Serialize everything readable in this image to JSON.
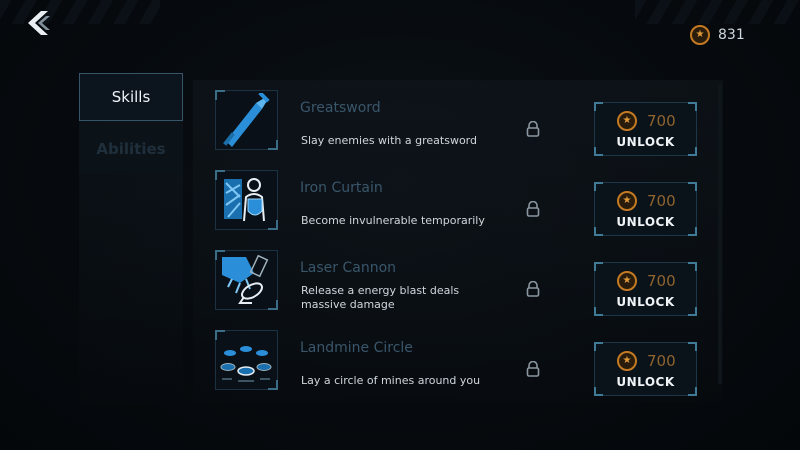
{
  "header": {
    "currency_icon": "star-coin-icon",
    "currency_amount": "831"
  },
  "tabs": [
    {
      "label": "Skills",
      "active": true
    },
    {
      "label": "Abilities",
      "active": false
    }
  ],
  "skills": [
    {
      "title": "Greatsword",
      "description": "Slay enemies with a greatsword",
      "icon": "greatsword-icon",
      "price": "700",
      "button_label": "UNLOCK",
      "locked": true
    },
    {
      "title": "Iron Curtain",
      "description": "Become invulnerable temporarily",
      "icon": "shield-figure-icon",
      "price": "700",
      "button_label": "UNLOCK",
      "locked": true
    },
    {
      "title": "Laser Cannon",
      "description": "Release a energy blast deals massive damage",
      "icon": "laser-cannon-icon",
      "price": "700",
      "button_label": "UNLOCK",
      "locked": true
    },
    {
      "title": "Landmine Circle",
      "description": "Lay a circle of mines around you",
      "icon": "landmines-icon",
      "price": "700",
      "button_label": "UNLOCK",
      "locked": true
    }
  ],
  "colors": {
    "accent_blue": "#2a8fd8",
    "coin_orange": "#c47a22",
    "title_muted": "#39566a",
    "background": "#06090c"
  }
}
